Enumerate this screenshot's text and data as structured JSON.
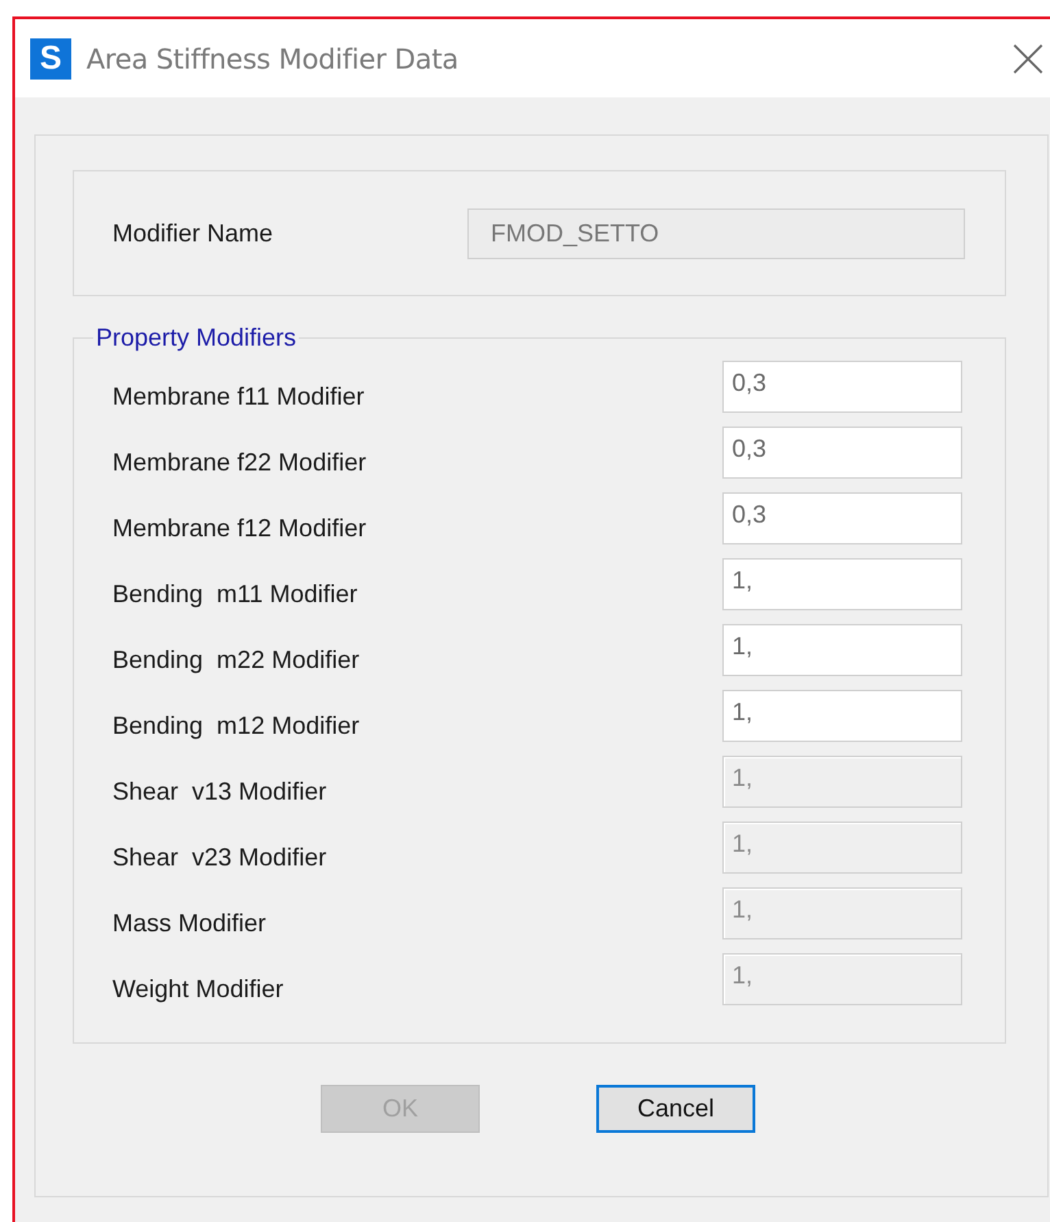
{
  "window": {
    "icon_letter": "S",
    "title": "Area Stiffness Modifier Data"
  },
  "modifier_name": {
    "label": "Modifier Name",
    "value": "FMOD_SETTO",
    "disabled": true
  },
  "property_modifiers": {
    "title": "Property Modifiers",
    "rows": [
      {
        "label": "Membrane f11 Modifier",
        "value": "0,3",
        "disabled": false
      },
      {
        "label": "Membrane f22 Modifier",
        "value": "0,3",
        "disabled": false
      },
      {
        "label": "Membrane f12 Modifier",
        "value": "0,3",
        "disabled": false
      },
      {
        "label": "Bending  m11 Modifier",
        "value": "1,",
        "disabled": false
      },
      {
        "label": "Bending  m22 Modifier",
        "value": "1,",
        "disabled": false
      },
      {
        "label": "Bending  m12 Modifier",
        "value": "1,",
        "disabled": false
      },
      {
        "label": "Shear  v13 Modifier",
        "value": "1,",
        "disabled": true
      },
      {
        "label": "Shear  v23 Modifier",
        "value": "1,",
        "disabled": true
      },
      {
        "label": "Mass Modifier",
        "value": "1,",
        "disabled": true
      },
      {
        "label": "Weight Modifier",
        "value": "1,",
        "disabled": true
      }
    ]
  },
  "buttons": [
    {
      "label": "OK",
      "disabled": true,
      "focused": false
    },
    {
      "label": "Cancel",
      "disabled": false,
      "focused": true
    }
  ]
}
